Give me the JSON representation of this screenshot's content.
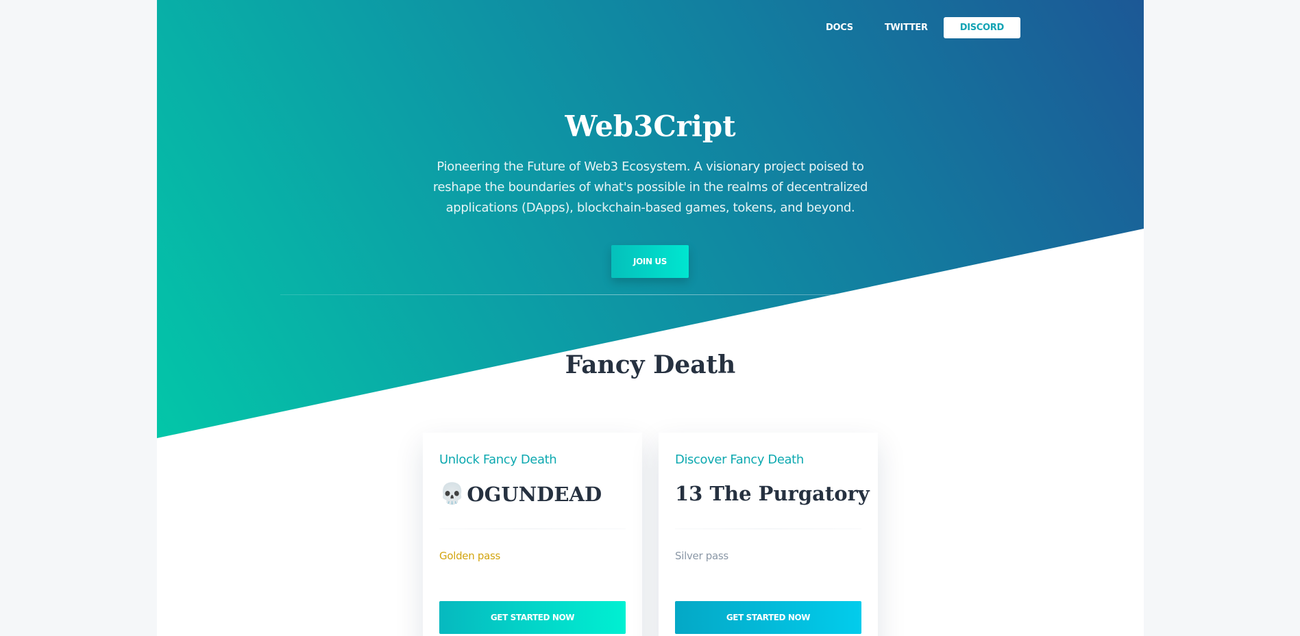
{
  "nav": {
    "docs": "DOCS",
    "twitter": "TWITTER",
    "discord": "DISCORD"
  },
  "hero": {
    "title": "Web3Cript",
    "subtitle": "Pioneering the Future of Web3 Ecosystem. A visionary project poised to reshape the boundaries of what's possible in the realms of decentralized applications (DApps), blockchain-based games, tokens, and beyond.",
    "cta": "JOIN US"
  },
  "section": {
    "title": "Fancy Death"
  },
  "cards": [
    {
      "eyebrow": "Unlock Fancy Death",
      "icon": "💀",
      "title": "OGUNDEAD",
      "pass": "Golden pass",
      "button": "GET STARTED NOW"
    },
    {
      "eyebrow": "Discover Fancy Death",
      "title": "13 The Purgatory",
      "pass": "Silver pass",
      "button": "GET STARTED NOW"
    }
  ],
  "colors": {
    "accent": "#0ea9b0",
    "gold": "#d2a40f",
    "silver": "#8a97a6",
    "heading": "#263140"
  }
}
